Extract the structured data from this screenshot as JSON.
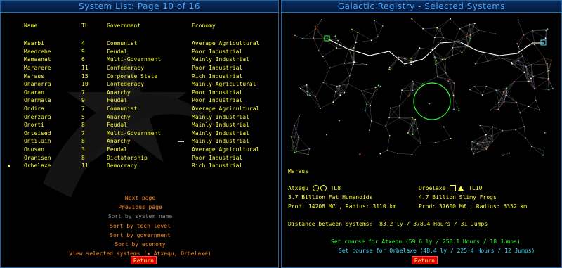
{
  "left": {
    "title": "System List: Page 10 of 16",
    "columns": {
      "name": "Name",
      "tl": "TL",
      "gov": "Government",
      "eco": "Economy"
    },
    "rows": [
      {
        "name": "Maarbi",
        "tl": "4",
        "gov": "Communist",
        "eco": "Average Agricultural",
        "selected": false
      },
      {
        "name": "Maedrebe",
        "tl": "9",
        "gov": "Feudal",
        "eco": "Poor Industrial",
        "selected": false
      },
      {
        "name": "Mamaanat",
        "tl": "6",
        "gov": "Multi-Government",
        "eco": "Mainly Industrial",
        "selected": false
      },
      {
        "name": "Mararere",
        "tl": "11",
        "gov": "Confederacy",
        "eco": "Poor Industrial",
        "selected": false
      },
      {
        "name": "Maraus",
        "tl": "15",
        "gov": "Corporate State",
        "eco": "Rich Industrial",
        "selected": false
      },
      {
        "name": "Onanorra",
        "tl": "10",
        "gov": "Confederacy",
        "eco": "Mainly Agricultural",
        "selected": false
      },
      {
        "name": "Onaran",
        "tl": "7",
        "gov": "Anarchy",
        "eco": "Poor Industrial",
        "selected": false
      },
      {
        "name": "Onarmala",
        "tl": "9",
        "gov": "Feudal",
        "eco": "Poor Industrial",
        "selected": false
      },
      {
        "name": "Ondira",
        "tl": "7",
        "gov": "Communist",
        "eco": "Average Agricultural",
        "selected": false
      },
      {
        "name": "Onerzara",
        "tl": "5",
        "gov": "Anarchy",
        "eco": "Mainly Industrial",
        "selected": false
      },
      {
        "name": "Onorti",
        "tl": "8",
        "gov": "Feudal",
        "eco": "Mainly Industrial",
        "selected": false
      },
      {
        "name": "Onteised",
        "tl": "7",
        "gov": "Multi-Government",
        "eco": "Mainly Industrial",
        "selected": false
      },
      {
        "name": "Ontilain",
        "tl": "8",
        "gov": "Anarchy",
        "eco": "Mainly Industrial",
        "selected": false
      },
      {
        "name": "Onusan",
        "tl": "3",
        "gov": "Feudal",
        "eco": "Average Agricultural",
        "selected": false
      },
      {
        "name": "Oranisen",
        "tl": "8",
        "gov": "Dictatorship",
        "eco": "Poor Industrial",
        "selected": false
      },
      {
        "name": "Orbelaxe",
        "tl": "11",
        "gov": "Democracy",
        "eco": "Rich Industrial",
        "selected": true
      }
    ],
    "menu": [
      {
        "label": "Next page",
        "enabled": true
      },
      {
        "label": "Previous page",
        "enabled": true
      },
      {
        "label": "Sort by system name",
        "enabled": false
      },
      {
        "label": "Sort by tech level",
        "enabled": true
      },
      {
        "label": "Sort by government",
        "enabled": true
      },
      {
        "label": "Sort by economy",
        "enabled": true
      },
      {
        "label": "View selected systems (★ Atxequ, Orbelaxe)",
        "enabled": true
      }
    ],
    "return_label": "Return"
  },
  "right": {
    "title": "Galactic Registry - Selected Systems",
    "current_system": "Maraus",
    "sys_a": {
      "name": "Atxequ",
      "tl": "TL8",
      "pop": "3.7 Billion Fat Humanoids",
      "prod_radius": "Prod: 14208 M₢ , Radius: 3110 km"
    },
    "sys_b": {
      "name": "Orbelaxe",
      "tl": "TL10",
      "pop": "4.7 Billion Slimy Frogs",
      "prod_radius": "Prod: 37600 M₢ , Radius: 5352 km"
    },
    "distance_label": "Distance between systems:",
    "distance_value": "83.2 ly / 378.4 Hours / 31 Jumps",
    "course_a": "Set course for Atxequ (59.6 ly / 250.1 Hours / 18 Jumps)",
    "course_b": "Set course for Orbelaxe (48.4 ly / 225.4 Hours / 12 Jumps)",
    "return_label": "Return"
  },
  "colors": {
    "text": "#ffff33",
    "menu": "#ff8a1e",
    "title": "#4aa6ff",
    "course_a": "#33ff33",
    "course_b": "#33ddff",
    "return_bg": "#e00000"
  }
}
